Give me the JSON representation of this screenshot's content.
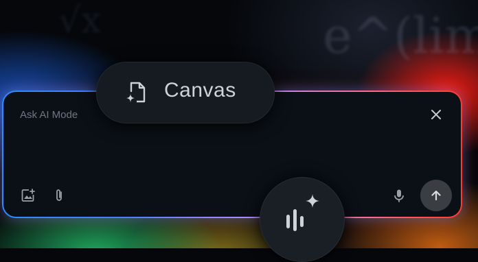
{
  "input": {
    "placeholder": "Ask AI Mode"
  },
  "chip": {
    "label": "Canvas",
    "icon": "document-sparkle-icon"
  },
  "toolbar": {
    "left_icons": [
      "add-image-icon",
      "attachment-icon"
    ],
    "right_icons": [
      "microphone-icon",
      "arrow-up-icon"
    ]
  },
  "close_icon": "close-icon",
  "voice_icon": "voice-sparkle-icon",
  "background_text": [
    "√x",
    "e^(lim"
  ],
  "colors": {
    "panel": "#0b1016",
    "border_left": "#2d8cff",
    "border_right": "#ff3b2f",
    "chip_bg": "#161b21",
    "text_muted": "#6f7683",
    "send_bg": "#3a3d42"
  }
}
